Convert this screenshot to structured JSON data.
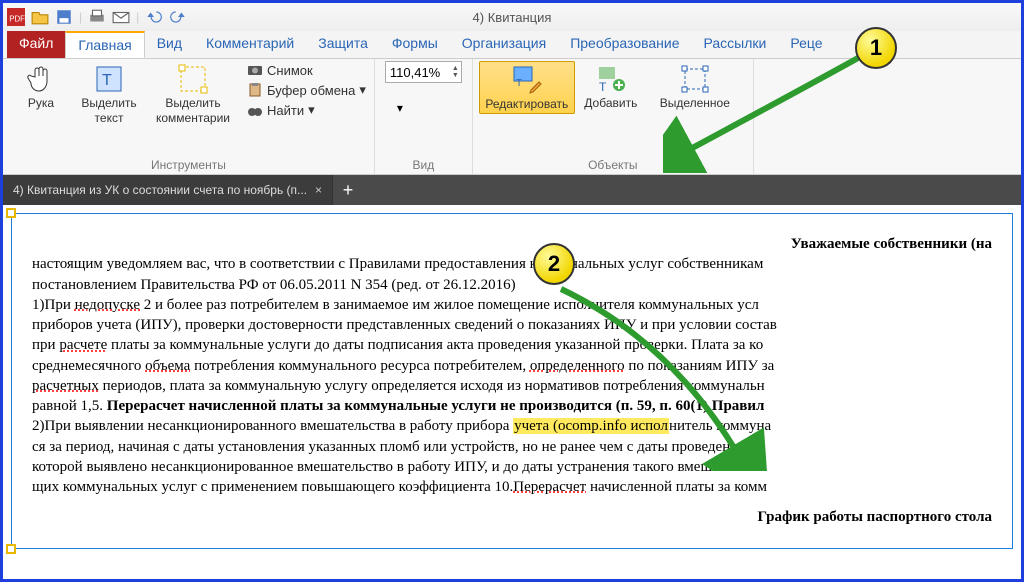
{
  "qat": {
    "title": "4) Квитанция"
  },
  "tabs": {
    "file": "Файл",
    "home": "Главная",
    "view": "Вид",
    "comment": "Комментарий",
    "protect": "Защита",
    "forms": "Формы",
    "organize": "Организация",
    "convert": "Преобразование",
    "mail": "Рассылки",
    "review": "Реце"
  },
  "ribbon": {
    "tools": {
      "hand": "Рука",
      "select_text_l1": "Выделить",
      "select_text_l2": "текст",
      "select_comments_l1": "Выделить",
      "select_comments_l2": "комментарии",
      "snapshot": "Снимок",
      "clipboard": "Буфер обмена",
      "find": "Найти",
      "group": "Инструменты"
    },
    "viewg": {
      "zoom_value": "110,41%",
      "group": "Вид"
    },
    "objects": {
      "edit": "Редактировать",
      "add": "Добавить",
      "selected": "Выделенное",
      "group": "Объекты"
    }
  },
  "doc_tab": {
    "title": "4) Квитанция из УК о состоянии счета по ноябрь (п...",
    "close": "×",
    "add": "+"
  },
  "doc": {
    "heading_right": "Уважаемые собственники (на",
    "p1a": "настоящим уведомляем вас, что в соответствии с Правилами предоставления коммунальных услуг собственникам",
    "p1b": "постановлением Правительства РФ от 06.05.2011 N 354 (ред. от 26.12.2016)",
    "p2a_pre": "1)При ",
    "p2a_u": "недопуске",
    "p2a_post": " 2 и более раз потребителем в занимаемое им жилое помещение исполнителя коммунальных усл",
    "p2b": "приборов учета (ИПУ), проверки достоверности представленных сведений о показаниях ИПУ и при условии состав",
    "p2c_pre": "при ",
    "p2c_u": "расчете",
    "p2c_post": " платы за коммунальные услуги до даты подписания акта проведения указанной проверки. Плата за ко",
    "p2d_pre": "среднемесячного ",
    "p2d_u1": "объема",
    "p2d_mid": " потребления коммунального ресурса потребителем, ",
    "p2d_u2": "определенного",
    "p2d_post": " по показаниям ИПУ за",
    "p2e_pre": "",
    "p2e_u": "расчетных",
    "p2e_post": " периодов, плата за коммунальную услугу определяется исходя из нормативов потребления коммунальн",
    "p2f": "равной 1,5. ",
    "p2f_b": "Перерасчет начисленной платы за коммунальные услуги не производится (п. 59, п. 60(1) Правил",
    "p3a_pre": "2)При выявлении несанкционированного вмешательства в работу прибора ",
    "p3a_hl": "учета (ocomp.info испол",
    "p3a_post": "нитель коммуна",
    "p3b": "ся за период, начиная с даты установления указанных пломб или устройств, но не ранее чем с даты проведения пр",
    "p3c": "которой выявлено несанкционированное вмешательство в работу ИПУ, и до даты устранения такого вмешательств",
    "p3d_pre": "щих коммунальных услуг с применением повышающего коэффициента 10.",
    "p3d_u": "Перерасчет",
    "p3d_post": " начисленной платы за комм",
    "footer": "График работы паспортного стола"
  },
  "callouts": {
    "one": "1",
    "two": "2"
  }
}
